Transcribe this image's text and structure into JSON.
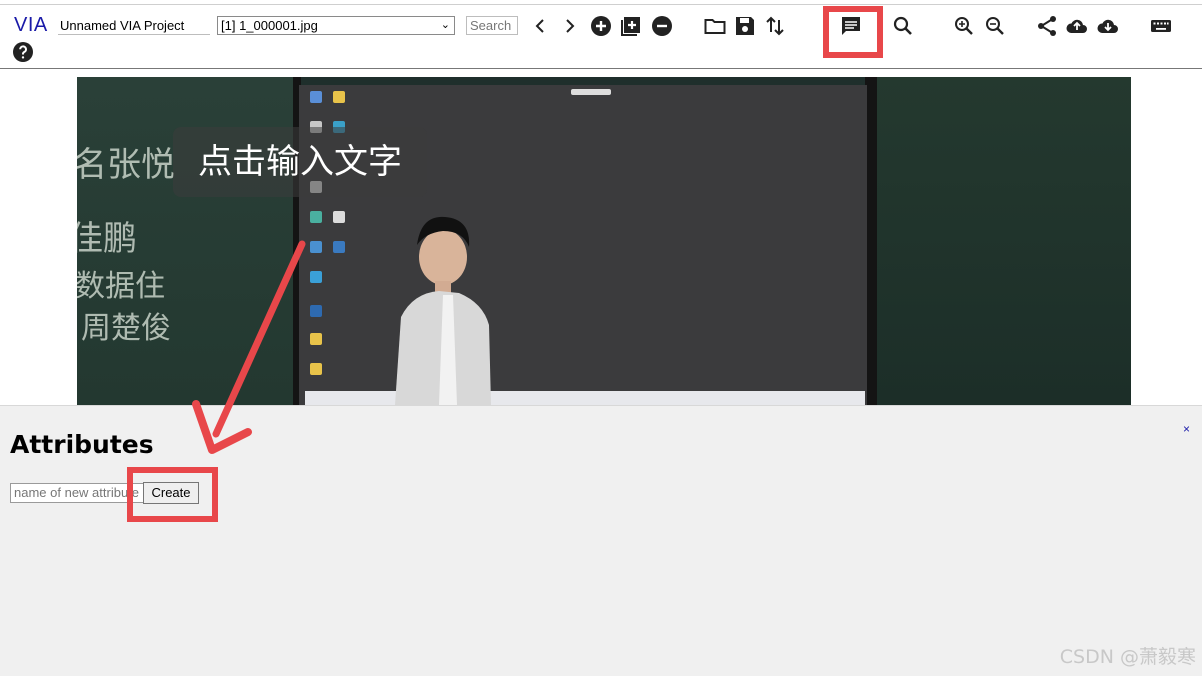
{
  "app": {
    "logo": "VIA",
    "project_name": "Unnamed VIA Project",
    "file_selected": "[1] 1_000001.jpg",
    "search_placeholder": "Search"
  },
  "toolbar": {
    "icons": [
      "chevron-left-icon",
      "chevron-right-icon",
      "add-circle-icon",
      "add-box-icon",
      "remove-circle-icon",
      "folder-icon",
      "save-icon",
      "swap-vert-icon",
      "comment-icon",
      "search-icon",
      "zoom-in-icon",
      "zoom-out-icon",
      "share-icon",
      "cloud-upload-icon",
      "cloud-download-icon",
      "keyboard-icon",
      "help-icon"
    ],
    "highlighted_icon": "comment-icon"
  },
  "image": {
    "overlay_text": "点击输入文字",
    "chalk_lines": [
      "名张悦",
      "佳鹏",
      "数据住",
      "周楚俊"
    ]
  },
  "attributes_panel": {
    "title": "Attributes",
    "close_label": "×",
    "new_attr_placeholder": "name of new attribute",
    "create_label": "Create"
  },
  "annotation": {
    "highlight_color": "#e8474a"
  },
  "watermark": "CSDN @萧毅寒"
}
